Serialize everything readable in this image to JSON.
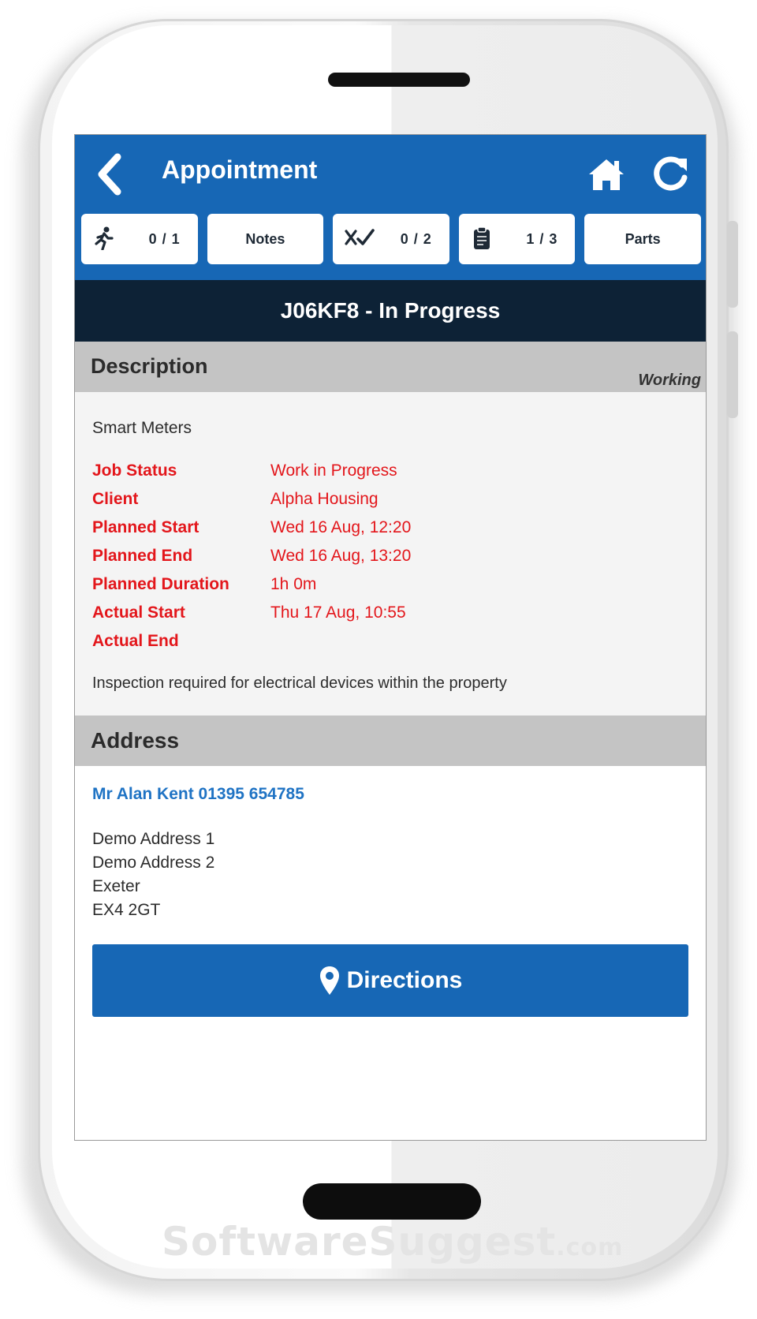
{
  "header": {
    "title": "Appointment",
    "back_icon": "chevron-left-icon",
    "home_icon": "home-icon",
    "refresh_icon": "refresh-icon"
  },
  "tabs": [
    {
      "id": "visits",
      "icon": "running-person-icon",
      "count": "0 / 1",
      "label": ""
    },
    {
      "id": "notes",
      "icon": "",
      "count": "",
      "label": "Notes"
    },
    {
      "id": "checks",
      "icon": "checklist-icon",
      "count": "0 / 2",
      "label": ""
    },
    {
      "id": "forms",
      "icon": "clipboard-icon",
      "count": "1 / 3",
      "label": ""
    },
    {
      "id": "parts",
      "icon": "",
      "count": "",
      "label": "Parts"
    }
  ],
  "job": {
    "header": "J06KF8 - In Progress"
  },
  "description": {
    "heading": "Description",
    "tag": "Working",
    "summary": "Smart Meters",
    "fields": [
      {
        "label": "Job Status",
        "value": "Work in Progress"
      },
      {
        "label": "Client",
        "value": "Alpha Housing"
      },
      {
        "label": "Planned Start",
        "value": "Wed 16 Aug, 12:20"
      },
      {
        "label": "Planned End",
        "value": "Wed 16 Aug, 13:20"
      },
      {
        "label": "Planned Duration",
        "value": "1h 0m"
      },
      {
        "label": "Actual Start",
        "value": "Thu 17 Aug, 10:55"
      },
      {
        "label": "Actual End",
        "value": ""
      }
    ],
    "note": "Inspection required for electrical devices within the property"
  },
  "address": {
    "heading": "Address",
    "contact": "Mr Alan Kent 01395 654785",
    "lines": [
      "Demo Address 1",
      "Demo Address 2",
      "Exeter",
      "EX4 2GT"
    ],
    "directions_label": "Directions",
    "directions_icon": "map-pin-icon"
  },
  "watermark": {
    "brand": "SoftwareSuggest",
    "suffix": ".com"
  },
  "colors": {
    "primary": "#1767b5",
    "dark_header": "#0d2236",
    "alert_red": "#e3161b",
    "link_blue": "#1f73c4",
    "section_grey": "#c4c4c4"
  }
}
